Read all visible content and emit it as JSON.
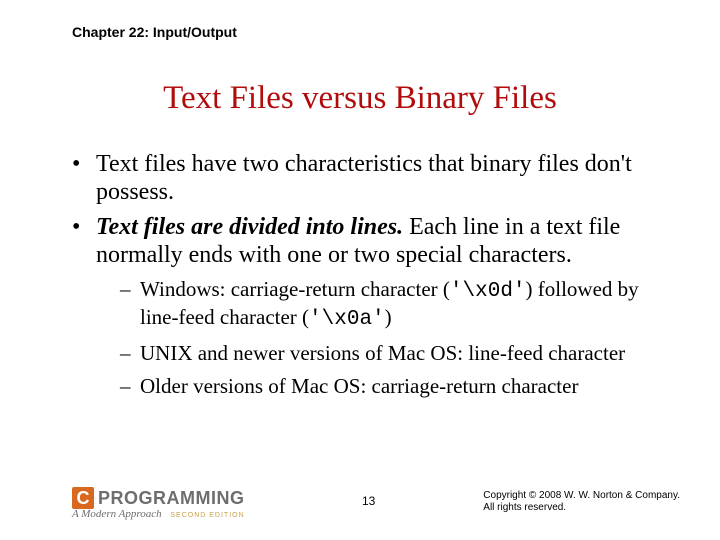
{
  "chapter": "Chapter 22: Input/Output",
  "title": "Text Files versus Binary Files",
  "bullets": {
    "b1": "Text files have two characteristics that binary files don't possess.",
    "b2_lead": "Text files are divided into lines.",
    "b2_rest": " Each line in a text file normally ends with one or two special characters.",
    "s1_a": "Windows: carriage-return character (",
    "s1_code1": "'\\x0d'",
    "s1_b": ") followed by line-feed character (",
    "s1_code2": "'\\x0a'",
    "s1_c": ")",
    "s2": "UNIX and newer versions of Mac OS: line-feed character",
    "s3": "Older versions of Mac OS: carriage-return character"
  },
  "footer": {
    "logo_c": "C",
    "logo_text": "PROGRAMMING",
    "logo_sub": "A Modern Approach",
    "logo_edition": "SECOND EDITION",
    "page": "13",
    "copy1": "Copyright © 2008 W. W. Norton & Company.",
    "copy2": "All rights reserved."
  }
}
